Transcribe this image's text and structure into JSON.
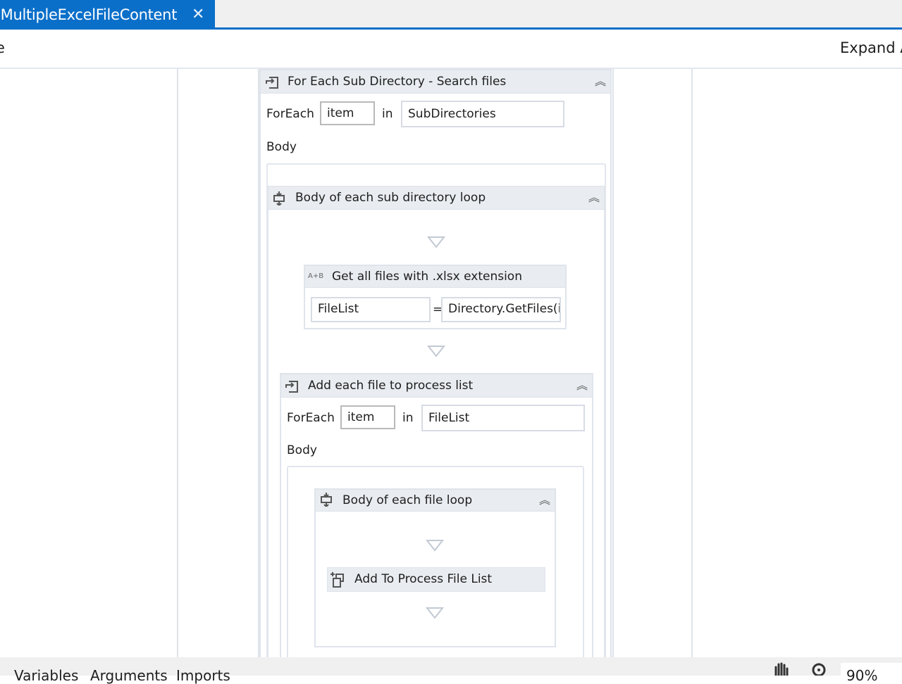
{
  "tabs": [
    {
      "label": "eMultipleExcelFileContent",
      "active": true,
      "close_icon": "close-icon"
    }
  ],
  "toolbar": {
    "breadcrumb": "e",
    "expand_all_label": "Expand A"
  },
  "workflow": {
    "outer_foreach": {
      "title": "For Each Sub Directory - Search files",
      "foreach_label": "ForEach",
      "item_value": "item",
      "in_label": "in",
      "collection_value": "SubDirectories",
      "body_label": "Body",
      "sequence": {
        "title": "Body of each sub directory loop",
        "assign": {
          "title": "Get all files with .xlsx extension",
          "icon_text": "A+B",
          "to_value": "FileList",
          "equals": "=",
          "expression_value": "Directory.GetFiles(i"
        },
        "inner_foreach": {
          "title": "Add each file to process list",
          "foreach_label": "ForEach",
          "item_value": "item",
          "in_label": "in",
          "collection_value": "FileList",
          "body_label": "Body",
          "sequence": {
            "title": "Body of each file loop",
            "activity": {
              "title": "Add To Process File List"
            }
          }
        }
      }
    },
    "collapse_glyph": "︽"
  },
  "statusbar": {
    "left_items": [
      "Variables",
      "Arguments",
      "Imports"
    ],
    "zoom_value": "90%",
    "icons": [
      "pan-hand-icon",
      "zoom-magnifier-icon"
    ]
  }
}
